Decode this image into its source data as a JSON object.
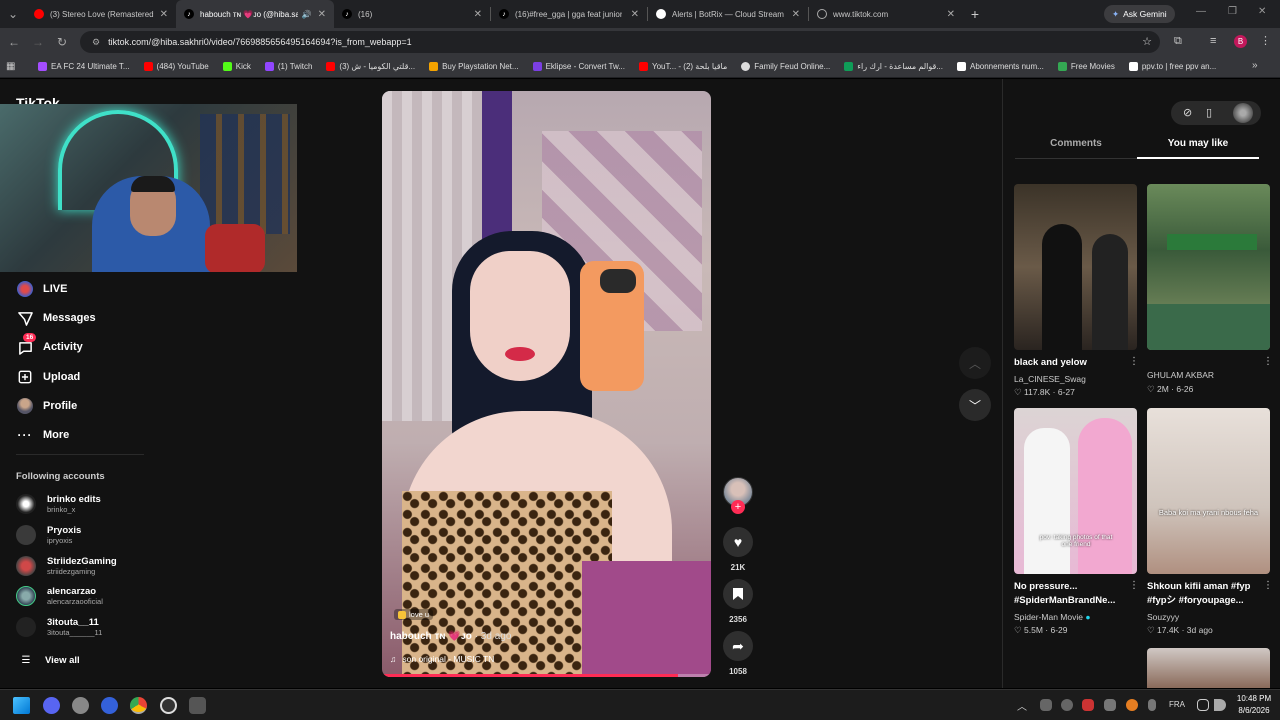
{
  "tabs": [
    {
      "title": "(3) Stereo Love (Remastered Ve",
      "color": "#ff0000"
    },
    {
      "title": "habouch ᴛɴ 💗ᴊᴏ (@hiba.sa",
      "color": "#ffffff"
    },
    {
      "title": "(16)",
      "color": "#ffffff"
    },
    {
      "title": "(16)#free_gga | gga feat junior",
      "color": "#ffffff"
    },
    {
      "title": "Alerts | BotRix — Cloud Stream",
      "color": "#ffffff"
    },
    {
      "title": "www.tiktok.com",
      "color": "#aaaaaa"
    }
  ],
  "ask_gemini": "Ask Gemini",
  "url": "tiktok.com/@hiba.sakhri0/video/7669885656495164694?is_from_webapp=1",
  "profile_letter": "B",
  "bookmarks": [
    {
      "label": "EA FC 24 Ultimate T...",
      "color": "#a44dff"
    },
    {
      "label": "(484) YouTube",
      "color": "#ff0000"
    },
    {
      "label": "Kick",
      "color": "#53fc18"
    },
    {
      "label": "(1) Twitch",
      "color": "#9146ff"
    },
    {
      "label": "(3) قلتي الكوميا - ش...",
      "color": "#ff0000"
    },
    {
      "label": "Buy Playstation Net...",
      "color": "#f4a300"
    },
    {
      "label": "Eklipse - Convert Tw...",
      "color": "#7b3fe4"
    },
    {
      "label": "YouT... - ماقيا بلحة (2)",
      "color": "#ff0000"
    },
    {
      "label": "Family Feud Online...",
      "color": "#dddddd"
    },
    {
      "label": "قوالم مساعدة - ارك راء...",
      "color": "#0f9d58"
    },
    {
      "label": "Abonnements num...",
      "color": "#ffffff"
    },
    {
      "label": "Free Movies",
      "color": "#34a853"
    },
    {
      "label": "ppv.to | free ppv an...",
      "color": "#ffffff"
    }
  ],
  "logo_text": "TikTok",
  "nav": [
    {
      "label": "LIVE",
      "icon": "live-icon"
    },
    {
      "label": "Messages",
      "icon": "messages-icon"
    },
    {
      "label": "Activity",
      "icon": "activity-icon",
      "badge": "16"
    },
    {
      "label": "Upload",
      "icon": "upload-icon"
    },
    {
      "label": "Profile",
      "icon": "profile-icon"
    },
    {
      "label": "More",
      "icon": "more-icon"
    }
  ],
  "following_title": "Following accounts",
  "following": [
    {
      "name": "brinko edits",
      "handle": "brinko_x"
    },
    {
      "name": "Pryoxis",
      "handle": "ipryoxis"
    },
    {
      "name": "StriidezGaming",
      "handle": "striidezgaming"
    },
    {
      "name": "alencarzao",
      "handle": "alencarzaooficial"
    },
    {
      "name": "3itouta__11",
      "handle": "3itouta______11"
    }
  ],
  "view_all": "View all",
  "video": {
    "sticker": "love u",
    "author": "habouch ᴛɴ 💗ᴊᴏ",
    "time": "· 3d ago",
    "music": "son original - MUSIC TN",
    "likes": "21K",
    "saves": "2356",
    "shares": "1058",
    "progress": 0.9
  },
  "panel_tabs": {
    "comments": "Comments",
    "you_may_like": "You may like"
  },
  "cards": [
    {
      "title": "black and yelow",
      "author": "La_CINESE_Swag",
      "likes": "117.8K",
      "date": "6-27"
    },
    {
      "title": "",
      "author": "GHULAM AKBAR",
      "likes": "2M",
      "date": "6-26"
    },
    {
      "title": "No pressure... #SpiderManBrandNe...",
      "author": "Spider-Man Movie",
      "likes": "5.5M",
      "date": "6-29",
      "overlay": "pov: taking photos of that one friend"
    },
    {
      "title": "Shkoun kifii aman #fyp #fypシ #foryoupage...",
      "author": "Souzyyy",
      "likes": "17.4K",
      "date": "3d ago",
      "overlay": "Baba koi ma yrani nbous feha"
    }
  ],
  "tray": {
    "lang": "FRA",
    "time": "10:48 PM",
    "date": "8/6/2026"
  }
}
